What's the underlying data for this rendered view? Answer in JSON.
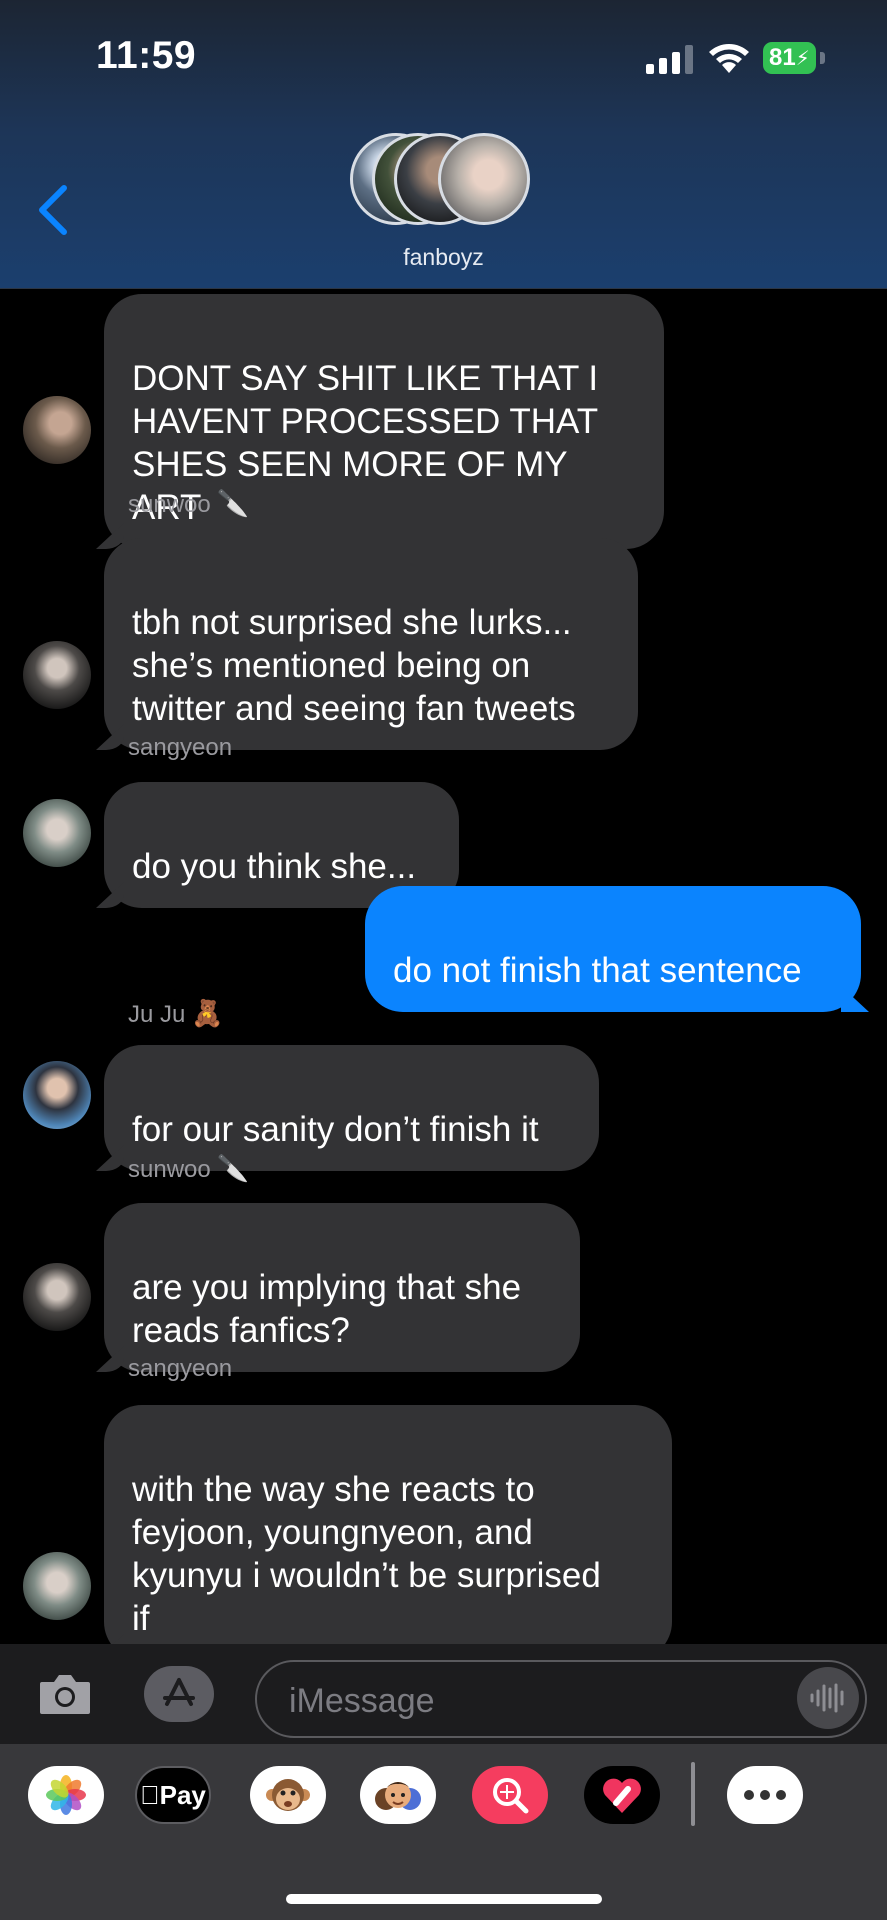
{
  "status_bar": {
    "time": "11:59",
    "battery": "81",
    "signal_bars_active": 3,
    "signal_bars_total": 4
  },
  "header": {
    "group_name": "fanboyz",
    "back_icon": "chevron-left-icon"
  },
  "messages": [
    {
      "direction": "in",
      "text": "DONT SAY SHIT LIKE THAT I\nHAVENT PROCESSED THAT\nSHES SEEN MORE OF MY ART"
    },
    {
      "direction": "in",
      "sender": "sunwoo",
      "sender_emoji": "🔪",
      "text": "tbh not surprised she lurks...\nshe’s mentioned being on\ntwitter and seeing fan tweets"
    },
    {
      "direction": "in",
      "sender": "sangyeon",
      "text": "do you think she..."
    },
    {
      "direction": "out",
      "text": "do not finish that sentence"
    },
    {
      "direction": "in",
      "sender": "Ju Ju",
      "sender_emoji": "🧸",
      "text": "for our sanity don’t finish it"
    },
    {
      "direction": "in",
      "sender": "sunwoo",
      "sender_emoji": "🔪",
      "text": "are you implying that she\nreads fanfics?"
    },
    {
      "direction": "in",
      "sender": "sangyeon",
      "text": "with the way she reacts to\nfeyjoon, youngnyeon, and\nkyunyu i wouldn’t be surprised\nif"
    }
  ],
  "compose": {
    "placeholder": "iMessage",
    "value": ""
  },
  "app_drawer": {
    "apple_pay_label": "Pay",
    "apps": [
      "photos-icon",
      "apple-pay-icon",
      "animoji-icon",
      "memoji-icon",
      "image-search-icon",
      "digital-touch-icon",
      "more-icon"
    ]
  },
  "colors": {
    "outgoing_bubble": "#0b84fe",
    "incoming_bubble": "#333335",
    "accent": "#0a84ff",
    "battery": "#32c153"
  }
}
